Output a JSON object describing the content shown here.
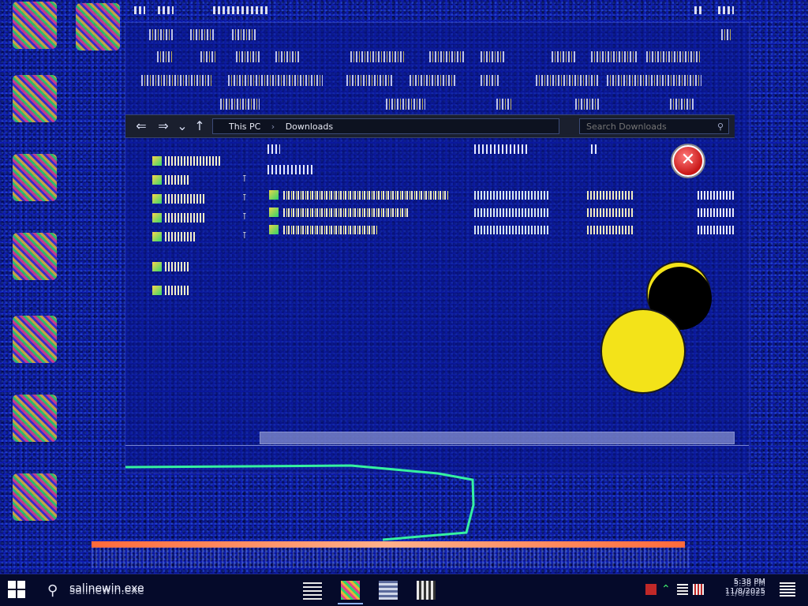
{
  "window": {
    "breadcrumb": [
      "This PC",
      "Downloads"
    ],
    "search_placeholder": "Search Downloads",
    "nav": {
      "back": "⇐",
      "forward": "⇒",
      "recent": "⌄",
      "up": "↑"
    }
  },
  "taskbar": {
    "search_value": "salinewin.exe",
    "clock": {
      "time": "5:38 PM",
      "date": "11/8/2025"
    }
  },
  "colors": {
    "desktop_bg": "#0b17a8",
    "yellow_ball": "#f3e319",
    "error_red": "#c81616",
    "trace_green": "#35f0a0"
  },
  "icons": {
    "error": "error-x-icon",
    "start": "windows-start-icon",
    "search": "search-icon"
  }
}
